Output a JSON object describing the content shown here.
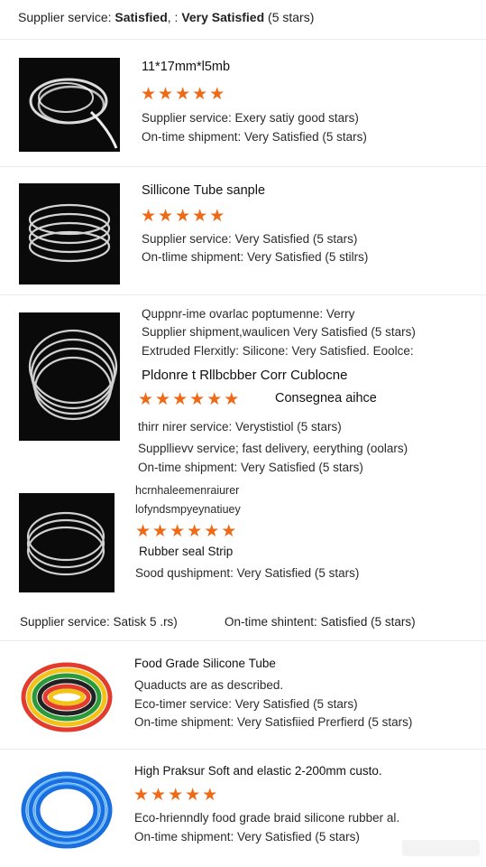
{
  "header": {
    "prefix": "Supplier service: ",
    "bold1": "Satisfied",
    "mid": ", : ",
    "bold2": "Very Satisfied",
    "suffix": " (5 stars)"
  },
  "star_icon": "star-icon",
  "accent_color": "#ee6a16",
  "products": [
    {
      "title": "11*17mm*l5mb",
      "rating": 5,
      "lines": [
        "Supplier service: Exery satiy good stars)",
        "On-time shipment: Very Satisfied (5 stars)"
      ]
    },
    {
      "title": "Sillicone Tube sanple",
      "rating": 5,
      "lines": [
        "Supplier service: Very Satisfied (5 stars)",
        "On-tlime shipment: Very Satisfied (5 stilrs)"
      ]
    },
    {
      "top_lines": [
        "Quppnr-ime ovarlac  poptumenne: Verry",
        "Supplier shipment,waulicen Very  Satisfied (5 stars)",
        "Extruded Flerxitly: Silicone: Very Satisfied. Eoolce:"
      ],
      "title": "Pldonre t Rllbcbber Corr Cublocne",
      "rating": 6,
      "side_label": "Consegnea aihce",
      "lines": [
        "thirr      nirer service: Verystistiol (5 stars)",
        "Suppllievv service; fast delivery, eerything (oolars)",
        "On-time shipment: Very Satisfied (5 stars)"
      ]
    },
    {
      "top_lines": [
        "hcrnhaleemenraiurer",
        "lofyndsmpyeynatiuey"
      ],
      "rating": 6,
      "title": "Rubber seal Strip",
      "lines": [
        "Sood qushipment: Very Satisfied (5 stars)"
      ]
    }
  ],
  "summary": {
    "left": "Supplier service: Satisk 5 .rs)",
    "right": "On-time shintent: Satisfied (5 stars)"
  },
  "products2": [
    {
      "title": "Food Grade Silicone Tube",
      "lines": [
        "Quaducts are as described.",
        "Eco-timer service: Very Satisfied (5 stars)",
        "On-time shipment: Very Satisfiied Prerfierd (5 stars)"
      ]
    },
    {
      "title": "High Praksur Soft and elastic 2-200mm custo.",
      "rating": 5,
      "lines": [
        "Eco-hrienndly food grade braid silicone rubber al.",
        "On-time shipment: Very Satisfied (5 stars)"
      ]
    }
  ]
}
